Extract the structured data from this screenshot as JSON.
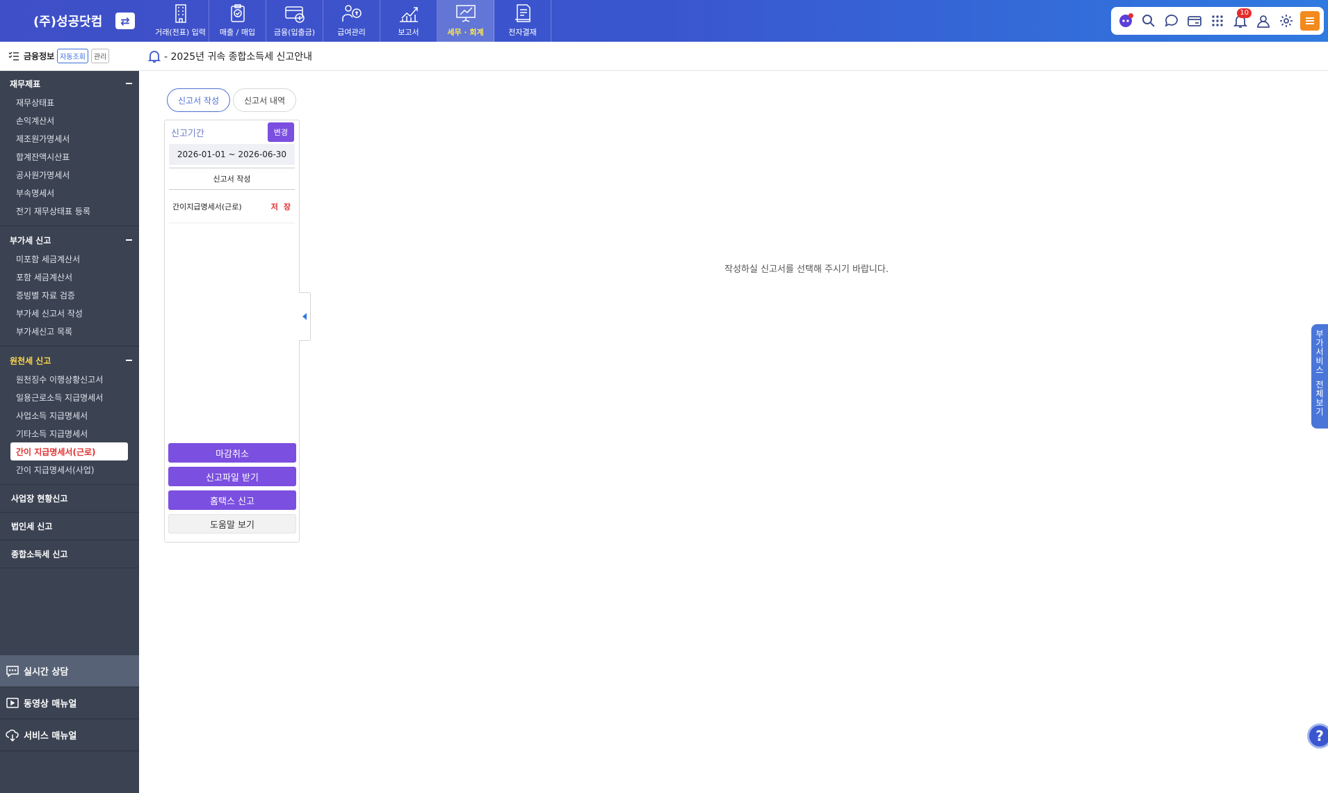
{
  "brand": {
    "name": "(주)성공닷컴",
    "switch_icon": "swap-icon"
  },
  "nav": [
    {
      "label": "거래(전표) 입력",
      "icon": "building-icon",
      "active": false
    },
    {
      "label": "매출 / 매입",
      "icon": "clipboard-check-icon",
      "active": false
    },
    {
      "label": "금융(입출금)",
      "icon": "card-money-icon",
      "active": false
    },
    {
      "label": "급여관리",
      "icon": "payroll-icon",
      "active": false
    },
    {
      "label": "보고서",
      "icon": "chart-up-icon",
      "active": false
    },
    {
      "label": "세무 · 회계",
      "icon": "presentation-chart-icon",
      "active": true
    },
    {
      "label": "전자결재",
      "icon": "document-sign-icon",
      "active": false
    }
  ],
  "toolbar": {
    "notification_count": "10",
    "accent": "#f28a1d"
  },
  "sidebar": {
    "finance": {
      "label": "금융정보",
      "tag_auto": "자동조회",
      "tag_manage": "관리"
    },
    "sections": [
      {
        "title": "재무제표",
        "items": [
          "재무상태표",
          "손익계산서",
          "제조원가명세서",
          "합계잔액시산표",
          "공사원가명세서",
          "부속명세서",
          "전기 재무상태표 등록"
        ]
      },
      {
        "title": "부가세 신고",
        "items": [
          "미포함 세금계산서",
          "포함 세금계산서",
          "증빙별 자료 검증",
          "부가세 신고서 작성",
          "부가세신고 목록"
        ]
      },
      {
        "title": "원천세 신고",
        "items": [
          "원천징수 이행상황신고서",
          "일용근로소득 지급명세서",
          "사업소득 지급명세서",
          "기타소득 지급명세서",
          "간이 지급명세서(근로)",
          "간이 지급명세서(사업)"
        ]
      }
    ],
    "plain_items": [
      "사업장 현황신고",
      "법인세 신고",
      "종합소득세 신고"
    ],
    "bottom": [
      {
        "label": "실시간 상담",
        "icon": "chat-icon"
      },
      {
        "label": "동영상 매뉴얼",
        "icon": "video-icon"
      },
      {
        "label": "서비스 매뉴얼",
        "icon": "cloud-download-icon"
      }
    ]
  },
  "page": {
    "title": "- 2025년 귀속 종합소득세 신고안내"
  },
  "tabs": [
    {
      "label": "신고서 작성"
    },
    {
      "label": "신고서 내역"
    }
  ],
  "panel": {
    "period_label": "신고기간",
    "change_label": "변경",
    "period_value": "2026-01-01 ~ 2026-06-30",
    "sub_head": "신고서 작성",
    "form_name": "간이지급명세서(근로)",
    "form_status": "저장",
    "buttons": {
      "cancel_close": "마감취소",
      "download_file": "신고파일 받기",
      "hometax": "홈택스 신고",
      "help": "도움말 보기"
    }
  },
  "empty_message": "작성하실 신고서를 선택해 주시기 바랍니다.",
  "side_tab": {
    "line1": "부가서비스",
    "line2": "전체보기"
  }
}
